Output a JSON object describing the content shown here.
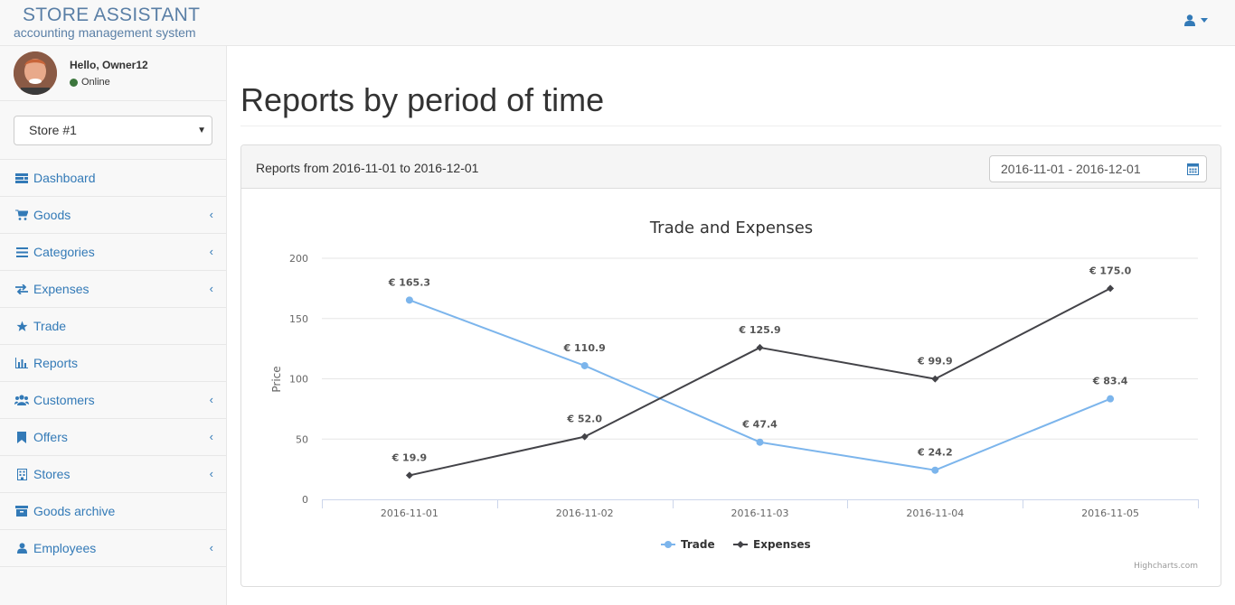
{
  "brand": {
    "title": "STORE ASSISTANT",
    "subtitle": "accounting management system"
  },
  "user": {
    "greeting": "Hello, Owner12",
    "status": "Online"
  },
  "store_select": {
    "value": "Store #1"
  },
  "nav": [
    {
      "label": "Dashboard",
      "icon": "dashboard-icon",
      "submenu": false
    },
    {
      "label": "Goods",
      "icon": "cart-icon",
      "submenu": true
    },
    {
      "label": "Categories",
      "icon": "list-icon",
      "submenu": true
    },
    {
      "label": "Expenses",
      "icon": "transfer-icon",
      "submenu": true
    },
    {
      "label": "Trade",
      "icon": "star-icon",
      "submenu": false
    },
    {
      "label": "Reports",
      "icon": "bar-chart-icon",
      "submenu": false
    },
    {
      "label": "Customers",
      "icon": "users-icon",
      "submenu": true
    },
    {
      "label": "Offers",
      "icon": "bookmark-icon",
      "submenu": true
    },
    {
      "label": "Stores",
      "icon": "building-icon",
      "submenu": true
    },
    {
      "label": "Goods archive",
      "icon": "archive-icon",
      "submenu": false
    },
    {
      "label": "Employees",
      "icon": "user-icon",
      "submenu": true
    }
  ],
  "page": {
    "title": "Reports by period of time"
  },
  "panel": {
    "title": "Reports from 2016-11-01 to 2016-12-01",
    "date_range": "2016-11-01 - 2016-12-01"
  },
  "chart_data": {
    "type": "line",
    "title": "Trade and Expenses",
    "xlabel": "",
    "ylabel": "Price",
    "categories": [
      "2016-11-01",
      "2016-11-02",
      "2016-11-03",
      "2016-11-04",
      "2016-11-05"
    ],
    "ylim": [
      0,
      200
    ],
    "yticks": [
      0,
      50,
      100,
      150,
      200
    ],
    "grid": true,
    "legend": "bottom-center",
    "value_prefix": "€ ",
    "series": [
      {
        "name": "Trade",
        "values": [
          165.3,
          110.9,
          47.4,
          24.2,
          83.4
        ],
        "color": "#7cb5ec",
        "marker": "circle"
      },
      {
        "name": "Expenses",
        "values": [
          19.9,
          52.0,
          125.9,
          99.9,
          175.0
        ],
        "color": "#434348",
        "marker": "diamond"
      }
    ],
    "credits": "Highcharts.com"
  }
}
